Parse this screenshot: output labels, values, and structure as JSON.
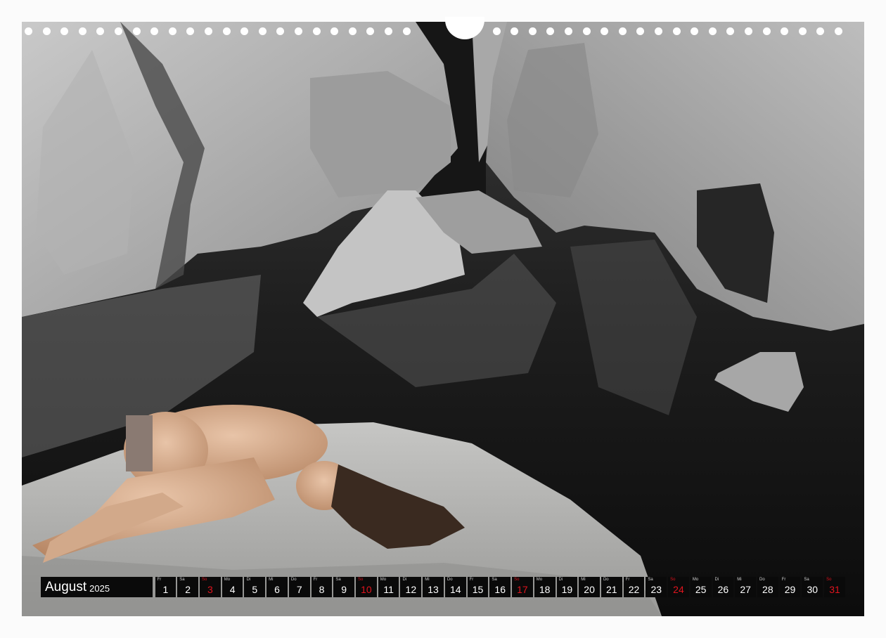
{
  "photo": {
    "description_icon": "rock-canyon-photo-icon"
  },
  "calendar": {
    "month": "August",
    "year": "2025",
    "days": [
      {
        "wd": "Fr",
        "d": "1",
        "hl": false
      },
      {
        "wd": "Sa",
        "d": "2",
        "hl": false
      },
      {
        "wd": "So",
        "d": "3",
        "hl": true
      },
      {
        "wd": "Mo",
        "d": "4",
        "hl": false
      },
      {
        "wd": "Di",
        "d": "5",
        "hl": false
      },
      {
        "wd": "Mi",
        "d": "6",
        "hl": false
      },
      {
        "wd": "Do",
        "d": "7",
        "hl": false
      },
      {
        "wd": "Fr",
        "d": "8",
        "hl": false
      },
      {
        "wd": "Sa",
        "d": "9",
        "hl": false
      },
      {
        "wd": "So",
        "d": "10",
        "hl": true
      },
      {
        "wd": "Mo",
        "d": "11",
        "hl": false
      },
      {
        "wd": "Di",
        "d": "12",
        "hl": false
      },
      {
        "wd": "Mi",
        "d": "13",
        "hl": false
      },
      {
        "wd": "Do",
        "d": "14",
        "hl": false
      },
      {
        "wd": "Fr",
        "d": "15",
        "hl": false
      },
      {
        "wd": "Sa",
        "d": "16",
        "hl": false
      },
      {
        "wd": "So",
        "d": "17",
        "hl": true
      },
      {
        "wd": "Mo",
        "d": "18",
        "hl": false
      },
      {
        "wd": "Di",
        "d": "19",
        "hl": false
      },
      {
        "wd": "Mi",
        "d": "20",
        "hl": false
      },
      {
        "wd": "Do",
        "d": "21",
        "hl": false
      },
      {
        "wd": "Fr",
        "d": "22",
        "hl": false
      },
      {
        "wd": "Sa",
        "d": "23",
        "hl": false
      },
      {
        "wd": "So",
        "d": "24",
        "hl": true
      },
      {
        "wd": "Mo",
        "d": "25",
        "hl": false
      },
      {
        "wd": "Di",
        "d": "26",
        "hl": false
      },
      {
        "wd": "Mi",
        "d": "27",
        "hl": false
      },
      {
        "wd": "Do",
        "d": "28",
        "hl": false
      },
      {
        "wd": "Fr",
        "d": "29",
        "hl": false
      },
      {
        "wd": "Sa",
        "d": "30",
        "hl": false
      },
      {
        "wd": "So",
        "d": "31",
        "hl": true
      }
    ]
  },
  "colors": {
    "highlight": "#e0141e",
    "bar": "#0a0a0a"
  }
}
